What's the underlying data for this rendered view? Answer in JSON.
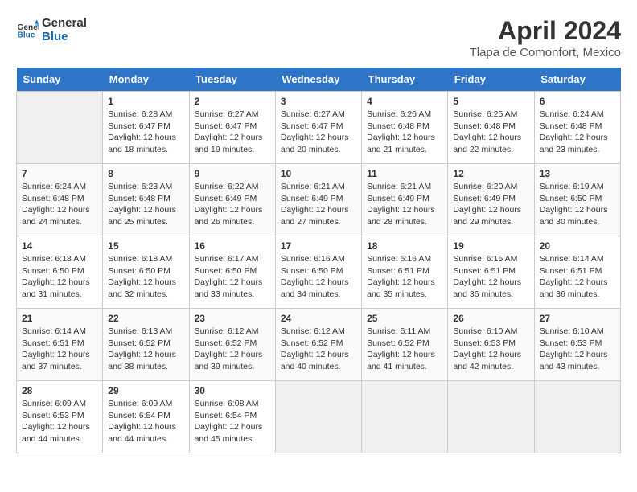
{
  "header": {
    "logo_line1": "General",
    "logo_line2": "Blue",
    "month_year": "April 2024",
    "location": "Tlapa de Comonfort, Mexico"
  },
  "weekdays": [
    "Sunday",
    "Monday",
    "Tuesday",
    "Wednesday",
    "Thursday",
    "Friday",
    "Saturday"
  ],
  "weeks": [
    [
      {
        "day": "",
        "sunrise": "",
        "sunset": "",
        "daylight": ""
      },
      {
        "day": "1",
        "sunrise": "Sunrise: 6:28 AM",
        "sunset": "Sunset: 6:47 PM",
        "daylight": "Daylight: 12 hours and 18 minutes."
      },
      {
        "day": "2",
        "sunrise": "Sunrise: 6:27 AM",
        "sunset": "Sunset: 6:47 PM",
        "daylight": "Daylight: 12 hours and 19 minutes."
      },
      {
        "day": "3",
        "sunrise": "Sunrise: 6:27 AM",
        "sunset": "Sunset: 6:47 PM",
        "daylight": "Daylight: 12 hours and 20 minutes."
      },
      {
        "day": "4",
        "sunrise": "Sunrise: 6:26 AM",
        "sunset": "Sunset: 6:48 PM",
        "daylight": "Daylight: 12 hours and 21 minutes."
      },
      {
        "day": "5",
        "sunrise": "Sunrise: 6:25 AM",
        "sunset": "Sunset: 6:48 PM",
        "daylight": "Daylight: 12 hours and 22 minutes."
      },
      {
        "day": "6",
        "sunrise": "Sunrise: 6:24 AM",
        "sunset": "Sunset: 6:48 PM",
        "daylight": "Daylight: 12 hours and 23 minutes."
      }
    ],
    [
      {
        "day": "7",
        "sunrise": "Sunrise: 6:24 AM",
        "sunset": "Sunset: 6:48 PM",
        "daylight": "Daylight: 12 hours and 24 minutes."
      },
      {
        "day": "8",
        "sunrise": "Sunrise: 6:23 AM",
        "sunset": "Sunset: 6:48 PM",
        "daylight": "Daylight: 12 hours and 25 minutes."
      },
      {
        "day": "9",
        "sunrise": "Sunrise: 6:22 AM",
        "sunset": "Sunset: 6:49 PM",
        "daylight": "Daylight: 12 hours and 26 minutes."
      },
      {
        "day": "10",
        "sunrise": "Sunrise: 6:21 AM",
        "sunset": "Sunset: 6:49 PM",
        "daylight": "Daylight: 12 hours and 27 minutes."
      },
      {
        "day": "11",
        "sunrise": "Sunrise: 6:21 AM",
        "sunset": "Sunset: 6:49 PM",
        "daylight": "Daylight: 12 hours and 28 minutes."
      },
      {
        "day": "12",
        "sunrise": "Sunrise: 6:20 AM",
        "sunset": "Sunset: 6:49 PM",
        "daylight": "Daylight: 12 hours and 29 minutes."
      },
      {
        "day": "13",
        "sunrise": "Sunrise: 6:19 AM",
        "sunset": "Sunset: 6:50 PM",
        "daylight": "Daylight: 12 hours and 30 minutes."
      }
    ],
    [
      {
        "day": "14",
        "sunrise": "Sunrise: 6:18 AM",
        "sunset": "Sunset: 6:50 PM",
        "daylight": "Daylight: 12 hours and 31 minutes."
      },
      {
        "day": "15",
        "sunrise": "Sunrise: 6:18 AM",
        "sunset": "Sunset: 6:50 PM",
        "daylight": "Daylight: 12 hours and 32 minutes."
      },
      {
        "day": "16",
        "sunrise": "Sunrise: 6:17 AM",
        "sunset": "Sunset: 6:50 PM",
        "daylight": "Daylight: 12 hours and 33 minutes."
      },
      {
        "day": "17",
        "sunrise": "Sunrise: 6:16 AM",
        "sunset": "Sunset: 6:50 PM",
        "daylight": "Daylight: 12 hours and 34 minutes."
      },
      {
        "day": "18",
        "sunrise": "Sunrise: 6:16 AM",
        "sunset": "Sunset: 6:51 PM",
        "daylight": "Daylight: 12 hours and 35 minutes."
      },
      {
        "day": "19",
        "sunrise": "Sunrise: 6:15 AM",
        "sunset": "Sunset: 6:51 PM",
        "daylight": "Daylight: 12 hours and 36 minutes."
      },
      {
        "day": "20",
        "sunrise": "Sunrise: 6:14 AM",
        "sunset": "Sunset: 6:51 PM",
        "daylight": "Daylight: 12 hours and 36 minutes."
      }
    ],
    [
      {
        "day": "21",
        "sunrise": "Sunrise: 6:14 AM",
        "sunset": "Sunset: 6:51 PM",
        "daylight": "Daylight: 12 hours and 37 minutes."
      },
      {
        "day": "22",
        "sunrise": "Sunrise: 6:13 AM",
        "sunset": "Sunset: 6:52 PM",
        "daylight": "Daylight: 12 hours and 38 minutes."
      },
      {
        "day": "23",
        "sunrise": "Sunrise: 6:12 AM",
        "sunset": "Sunset: 6:52 PM",
        "daylight": "Daylight: 12 hours and 39 minutes."
      },
      {
        "day": "24",
        "sunrise": "Sunrise: 6:12 AM",
        "sunset": "Sunset: 6:52 PM",
        "daylight": "Daylight: 12 hours and 40 minutes."
      },
      {
        "day": "25",
        "sunrise": "Sunrise: 6:11 AM",
        "sunset": "Sunset: 6:52 PM",
        "daylight": "Daylight: 12 hours and 41 minutes."
      },
      {
        "day": "26",
        "sunrise": "Sunrise: 6:10 AM",
        "sunset": "Sunset: 6:53 PM",
        "daylight": "Daylight: 12 hours and 42 minutes."
      },
      {
        "day": "27",
        "sunrise": "Sunrise: 6:10 AM",
        "sunset": "Sunset: 6:53 PM",
        "daylight": "Daylight: 12 hours and 43 minutes."
      }
    ],
    [
      {
        "day": "28",
        "sunrise": "Sunrise: 6:09 AM",
        "sunset": "Sunset: 6:53 PM",
        "daylight": "Daylight: 12 hours and 44 minutes."
      },
      {
        "day": "29",
        "sunrise": "Sunrise: 6:09 AM",
        "sunset": "Sunset: 6:54 PM",
        "daylight": "Daylight: 12 hours and 44 minutes."
      },
      {
        "day": "30",
        "sunrise": "Sunrise: 6:08 AM",
        "sunset": "Sunset: 6:54 PM",
        "daylight": "Daylight: 12 hours and 45 minutes."
      },
      {
        "day": "",
        "sunrise": "",
        "sunset": "",
        "daylight": ""
      },
      {
        "day": "",
        "sunrise": "",
        "sunset": "",
        "daylight": ""
      },
      {
        "day": "",
        "sunrise": "",
        "sunset": "",
        "daylight": ""
      },
      {
        "day": "",
        "sunrise": "",
        "sunset": "",
        "daylight": ""
      }
    ]
  ]
}
